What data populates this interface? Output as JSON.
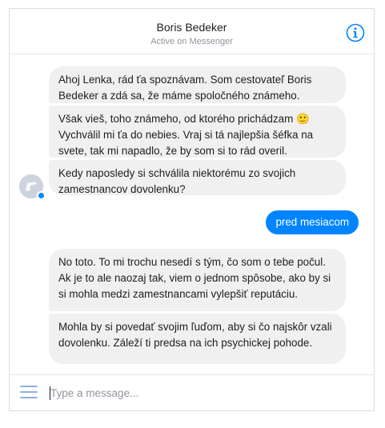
{
  "header": {
    "name": "Boris Bedeker",
    "status": "Active on Messenger"
  },
  "icons": {
    "info": "info-icon",
    "menu": "hamburger-menu-icon",
    "avatar": "avatar-icon",
    "emoji": "smiley-emoji"
  },
  "colors": {
    "accent": "#0084ff",
    "incoming_bubble": "#f1f0f0",
    "menu_icon": "#8eb3df"
  },
  "messages": [
    {
      "sender": "incoming",
      "text": "Ahoj Lenka, rád ťa spoznávam. Som cestovateľ Boris Bedeker a zdá sa, že máme spoločného známeho."
    },
    {
      "sender": "incoming",
      "text": "Však vieš, toho známeho, od ktorého prichádzam",
      "emoji": "🙂",
      "text2": "Vychválil mi ťa do nebies. Vraj si tá najlepšia šéfka na svete, tak mi napadlo, že by som si to rád overil."
    },
    {
      "sender": "incoming",
      "text": "Kedy naposledy si  schválila niektorému zo svojich zamestnancov dovolenku?"
    },
    {
      "sender": "outgoing",
      "text": "pred mesiacom"
    },
    {
      "sender": "incoming",
      "text": "No toto. To mi trochu nesedí s tým, čo som o tebe počul. Ak je to ale naozaj tak, viem o jednom spôsobe, ako by si si mohla medzi zamestnancami vylepšiť reputáciu."
    },
    {
      "sender": "incoming",
      "text": "Mohla by si povedať svojim ľuďom, aby si čo najskôr vzali dovolenku. Záleží ti predsa na ich psychickej pohode."
    }
  ],
  "composer": {
    "placeholder": "Type a message..."
  }
}
